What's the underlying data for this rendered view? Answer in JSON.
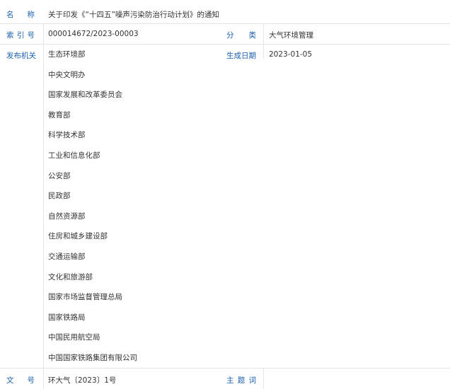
{
  "title_row": {
    "label": "名称",
    "value": "关于印发《“十四五”噪声污染防治行动计划》的通知"
  },
  "index_row": {
    "label": "索引号",
    "value": "000014672/2023-00003",
    "category_label": "分类",
    "category_value": "大气环境管理"
  },
  "issuer_row": {
    "label": "发布机关",
    "date_label": "生成日期",
    "date_value": "2023-01-05",
    "organizations": [
      "生态环境部",
      "中央文明办",
      "国家发展和改革委员会",
      "教育部",
      "科学技术部",
      "工业和信息化部",
      "公安部",
      "民政部",
      "自然资源部",
      "住房和城乡建设部",
      "交通运输部",
      "文化和旅游部",
      "国家市场监督管理总局",
      "国家铁路局",
      "中国民用航空局",
      "中国国家铁路集团有限公司"
    ]
  },
  "doc_row": {
    "label": "文号",
    "value": "环大气〔2023〕1号",
    "subject_label": "主题词",
    "subject_value": ""
  },
  "colors": {
    "label": "#1b5fae",
    "text": "#333333",
    "divider": "#e4e4e4"
  }
}
